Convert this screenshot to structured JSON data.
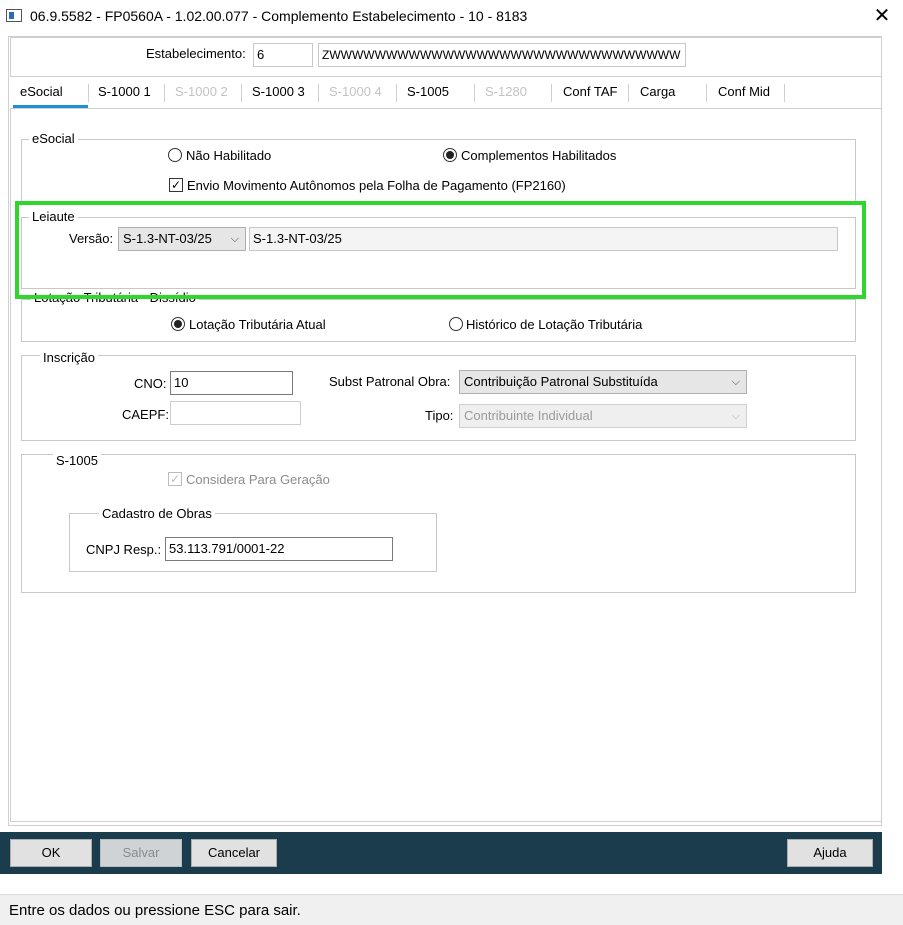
{
  "window": {
    "title": "06.9.5582 - FP0560A - 1.02.00.077 - Complemento Estabelecimento - 10 - 8183",
    "close_glyph": "✕"
  },
  "estabelecimento": {
    "label": "Estabelecimento:",
    "code": "6",
    "name": "ZWWWWWWWWWWWWWWWWWWWWWWWWWWWWWWW"
  },
  "tabs": [
    {
      "label": "eSocial",
      "enabled": true,
      "active": true
    },
    {
      "label": "S-1000 1",
      "enabled": true
    },
    {
      "label": "S-1000 2",
      "enabled": false
    },
    {
      "label": "S-1000 3",
      "enabled": true
    },
    {
      "label": "S-1000 4",
      "enabled": false
    },
    {
      "label": "S-1005",
      "enabled": true
    },
    {
      "label": "S-1280",
      "enabled": false
    },
    {
      "label": "Conf TAF",
      "enabled": true
    },
    {
      "label": "Carga",
      "enabled": true
    },
    {
      "label": "Conf Mid",
      "enabled": true
    }
  ],
  "esocial_group": {
    "title": "eSocial",
    "radio_nao": "Não Habilitado",
    "radio_comp": "Complementos Habilitados",
    "selected": "Complementos Habilitados",
    "checkbox_envio": "Envio Movimento Autônomos pela Folha de Pagamento (FP2160)",
    "checkbox_envio_checked": true
  },
  "leiaute_group": {
    "title": "Leiaute",
    "versao_label": "Versão:",
    "versao_select": "S-1.3-NT-03/25",
    "versao_text": "S-1.3-NT-03/25"
  },
  "lotacao_group": {
    "title": "Lotação Tributária - Dissídio",
    "radio_atual": "Lotação Tributária Atual",
    "radio_historico": "Histórico de Lotação Tributária",
    "selected": "Lotação Tributária Atual"
  },
  "inscricao_group": {
    "title": "Inscrição",
    "cno_label": "CNO:",
    "cno_value": "10",
    "caepf_label": "CAEPF:",
    "caepf_value": "",
    "subst_label": "Subst Patronal Obra:",
    "subst_value": "Contribuição Patronal Substituída",
    "tipo_label": "Tipo:",
    "tipo_value": "Contribuinte Individual"
  },
  "s1005_group": {
    "title": "S-1005",
    "considera_label": "Considera Para Geração",
    "considera_checked": true,
    "obras_title": "Cadastro de Obras",
    "cnpj_label": "CNPJ Resp.:",
    "cnpj_value": "53.113.791/0001-22"
  },
  "buttons": {
    "ok": "OK",
    "salvar": "Salvar",
    "cancelar": "Cancelar",
    "ajuda": "Ajuda"
  },
  "status_text": "Entre os dados ou pressione ESC para sair.",
  "colors": {
    "highlight": "#2fd62b",
    "tab_active_underline": "#1e90d6",
    "bottom_bar": "#1b3c4c"
  }
}
